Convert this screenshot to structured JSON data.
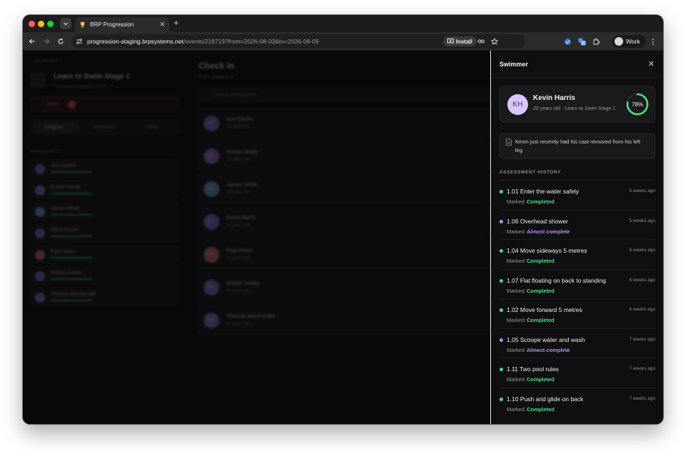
{
  "browser": {
    "tab_title": "BRP Progression",
    "url_host": "progression-staging.brpsystems.net",
    "url_path": "/events/218719?from=2026-08-03&to=2026-08-09",
    "install_label": "Install",
    "profile_label": "Work"
  },
  "background": {
    "back_link": "My sessions",
    "session_title": "Learn to Swim Stage 1",
    "session_meta": "Thursday 6 August, 17:45 · 7",
    "alerts_label": "Alerts",
    "tabs": [
      "Register",
      "Members",
      "Skills"
    ],
    "participants_header": "Participants (7)",
    "checkin_title": "Check in",
    "checkin_count": "0 of 7 checked in",
    "search_placeholder": "Search participants...",
    "participants": [
      {
        "initials": "AD",
        "name": "Ava Davies",
        "age": "15 years old",
        "color": "#7b6cc9"
      },
      {
        "initials": "EB",
        "name": "Evelyn Brady",
        "age": "11 years old",
        "color": "#9a6cc9"
      },
      {
        "initials": "JW",
        "name": "James White",
        "age": "14 years old",
        "color": "#6c9ac9"
      },
      {
        "initials": "KH",
        "name": "Kevin Harris",
        "age": "20 years old",
        "color": "#8a6cc9"
      },
      {
        "initials": "PD",
        "name": "Paul Dixon",
        "age": "17 years old",
        "color": "#c96c6c"
      },
      {
        "initials": "RH",
        "name": "Robert Hobbs",
        "age": "67 years old",
        "color": "#7b6cc9"
      },
      {
        "initials": "TM",
        "name": "Thomas MacDonald",
        "age": "22 years old",
        "color": "#8a6cc9"
      }
    ]
  },
  "drawer": {
    "title": "Swimmer",
    "swimmer": {
      "initials": "KH",
      "name": "Kevin Harris",
      "subtitle": "20 years old · Learn to Swim Stage 1",
      "progress": 0.78,
      "progress_label": "78%"
    },
    "note": "Kevin just recently had his cast removed from his left leg",
    "section_label": "ASSESSMENT HISTORY",
    "status_prefix": "Marked",
    "colors": {
      "completed": "#4ade80",
      "almost": "#b98cf7",
      "ring_track": "#2a2a2e"
    },
    "history": [
      {
        "title": "1.01 Enter the water safely",
        "time": "5 weeks ago",
        "status": "Completed",
        "kind": "completed"
      },
      {
        "title": "1.06 Overhead shower",
        "time": "5 weeks ago",
        "status": "Almost complete",
        "kind": "almost"
      },
      {
        "title": "1.04 Move sideways 5 metres",
        "time": "6 weeks ago",
        "status": "Completed",
        "kind": "completed"
      },
      {
        "title": "1.07 Flat floating on back to standing",
        "time": "6 weeks ago",
        "status": "Completed",
        "kind": "completed"
      },
      {
        "title": "1.02 Move forward 5 metres",
        "time": "6 weeks ago",
        "status": "Completed",
        "kind": "completed"
      },
      {
        "title": "1.05 Scoope water and wash",
        "time": "7 weeks ago",
        "status": "Almost complete",
        "kind": "almost"
      },
      {
        "title": "1.11 Two pool rules",
        "time": "7 weeks ago",
        "status": "Completed",
        "kind": "completed"
      },
      {
        "title": "1.10 Push and glide on back",
        "time": "7 weeks ago",
        "status": "Completed",
        "kind": "completed"
      }
    ]
  }
}
